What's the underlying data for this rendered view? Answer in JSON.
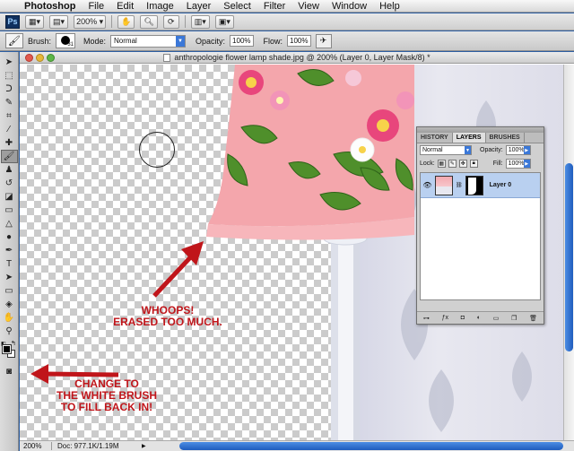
{
  "menubar": {
    "apple": "",
    "app_name": "Photoshop",
    "menus": [
      "File",
      "Edit",
      "Image",
      "Layer",
      "Select",
      "Filter",
      "View",
      "Window",
      "Help"
    ]
  },
  "appbar": {
    "logo": "Ps",
    "zoom": "200%"
  },
  "options": {
    "brush_label": "Brush:",
    "brush_size": "31",
    "mode_label": "Mode:",
    "mode_value": "Normal",
    "opacity_label": "Opacity:",
    "opacity_value": "100%",
    "flow_label": "Flow:",
    "flow_value": "100%"
  },
  "document": {
    "title": "anthropologie flower lamp shade.jpg @ 200% (Layer 0, Layer Mask/8) *",
    "status_zoom": "200%",
    "status_doc": "Doc: 977.1K/1.19M"
  },
  "annotations": {
    "whoops_line1": "WHOOPS!",
    "whoops_line2": "ERASED TOO MUCH.",
    "change_line1": "CHANGE TO",
    "change_line2": "THE WHITE BRUSH",
    "change_line3": "TO FILL BACK IN!"
  },
  "layers_panel": {
    "tabs": [
      "HISTORY",
      "LAYERS",
      "BRUSHES"
    ],
    "active_tab": "LAYERS",
    "blend_mode": "Normal",
    "opacity_label": "Opacity:",
    "opacity_value": "100%",
    "lock_label": "Lock:",
    "fill_label": "Fill:",
    "fill_value": "100%",
    "layer_name": "Layer 0"
  },
  "colors": {
    "annotation_red": "#c0151a",
    "lamp_pink": "#f4a6ac",
    "selection_blue": "#b9d0f0"
  }
}
